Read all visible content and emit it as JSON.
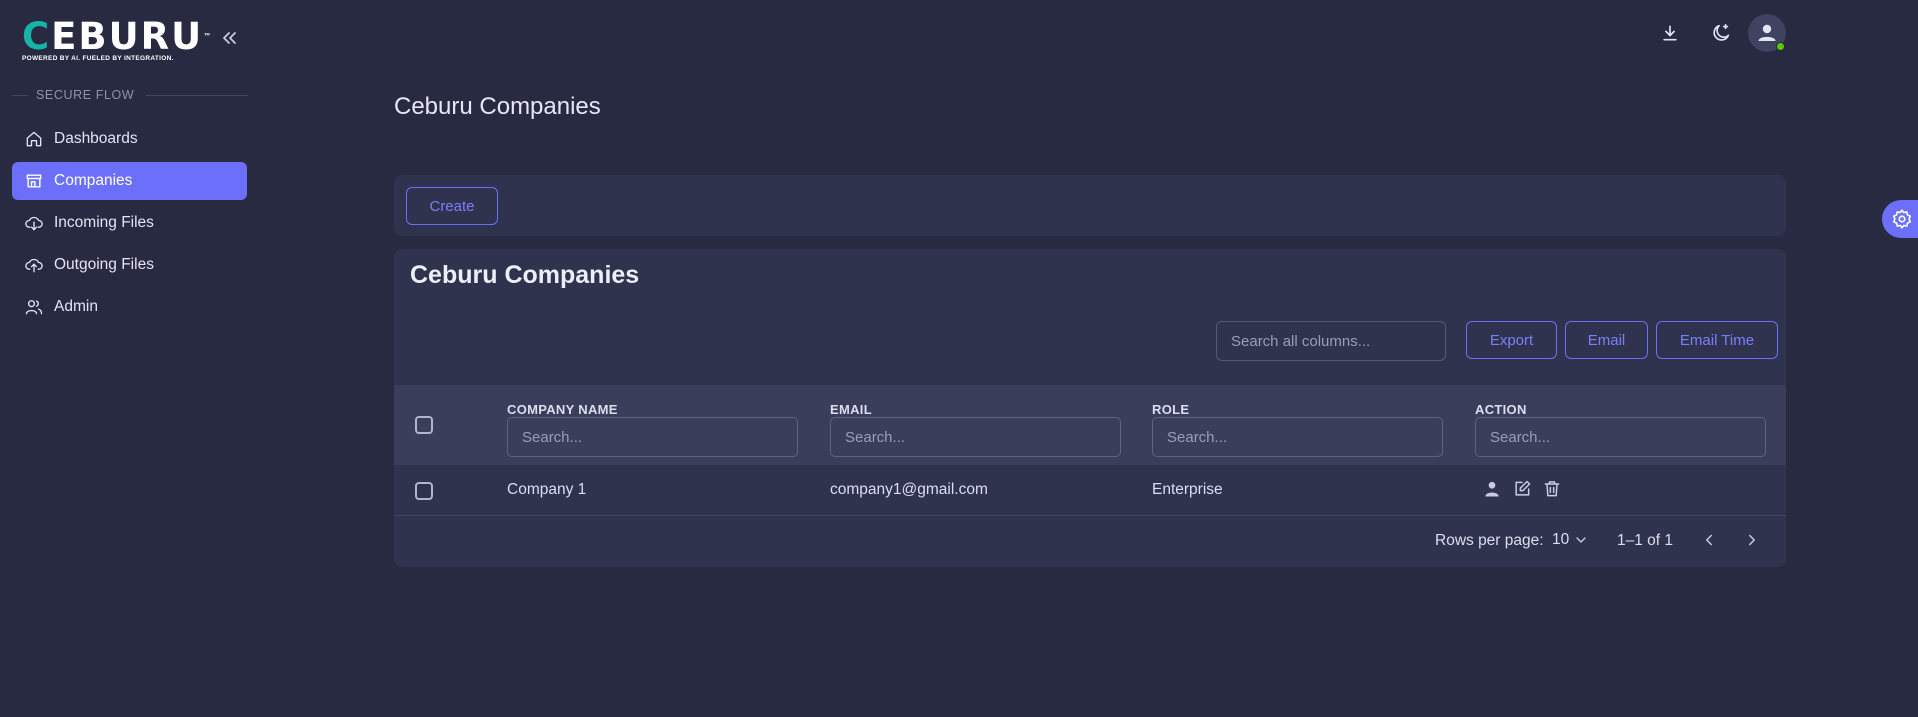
{
  "brand": {
    "logo_text": "CEBURU",
    "logo_first": "C",
    "logo_rest": "EBURU",
    "tagline": "POWERED BY AI. FUELED BY INTEGRATION.",
    "trademark": "™"
  },
  "sidebar": {
    "section_label": "SECURE FLOW",
    "items": [
      {
        "label": "Dashboards",
        "icon": "home-icon",
        "active": false
      },
      {
        "label": "Companies",
        "icon": "store-icon",
        "active": true
      },
      {
        "label": "Incoming Files",
        "icon": "cloud-download-icon",
        "active": false
      },
      {
        "label": "Outgoing Files",
        "icon": "cloud-upload-icon",
        "active": false
      },
      {
        "label": "Admin",
        "icon": "users-icon",
        "active": false
      }
    ]
  },
  "header": {
    "icons": [
      "download-icon",
      "theme-toggle-icon",
      "user-avatar"
    ]
  },
  "page": {
    "title": "Ceburu Companies"
  },
  "toolbar": {
    "create_label": "Create"
  },
  "table_card": {
    "title": "Ceburu Companies",
    "search_placeholder": "Search all columns...",
    "export_label": "Export",
    "email_label": "Email",
    "email_time_label": "Email Time",
    "columns": [
      {
        "header": "COMPANY NAME",
        "filter_placeholder": "Search..."
      },
      {
        "header": "EMAIL",
        "filter_placeholder": "Search..."
      },
      {
        "header": "ROLE",
        "filter_placeholder": "Search..."
      },
      {
        "header": "ACTION",
        "filter_placeholder": "Search..."
      }
    ],
    "rows": [
      {
        "company_name": "Company 1",
        "email": "company1@gmail.com",
        "role": "Enterprise",
        "actions": [
          "user-icon",
          "edit-icon",
          "trash-icon"
        ]
      }
    ],
    "footer": {
      "rows_per_page_label": "Rows per page:",
      "rows_per_page_value": "10",
      "range": "1–1 of 1"
    }
  },
  "colors": {
    "background": "#282a42",
    "card": "#30334e",
    "accent": "#6b6ff9",
    "logo_teal": "#17b3a6",
    "online": "#56ca00"
  }
}
